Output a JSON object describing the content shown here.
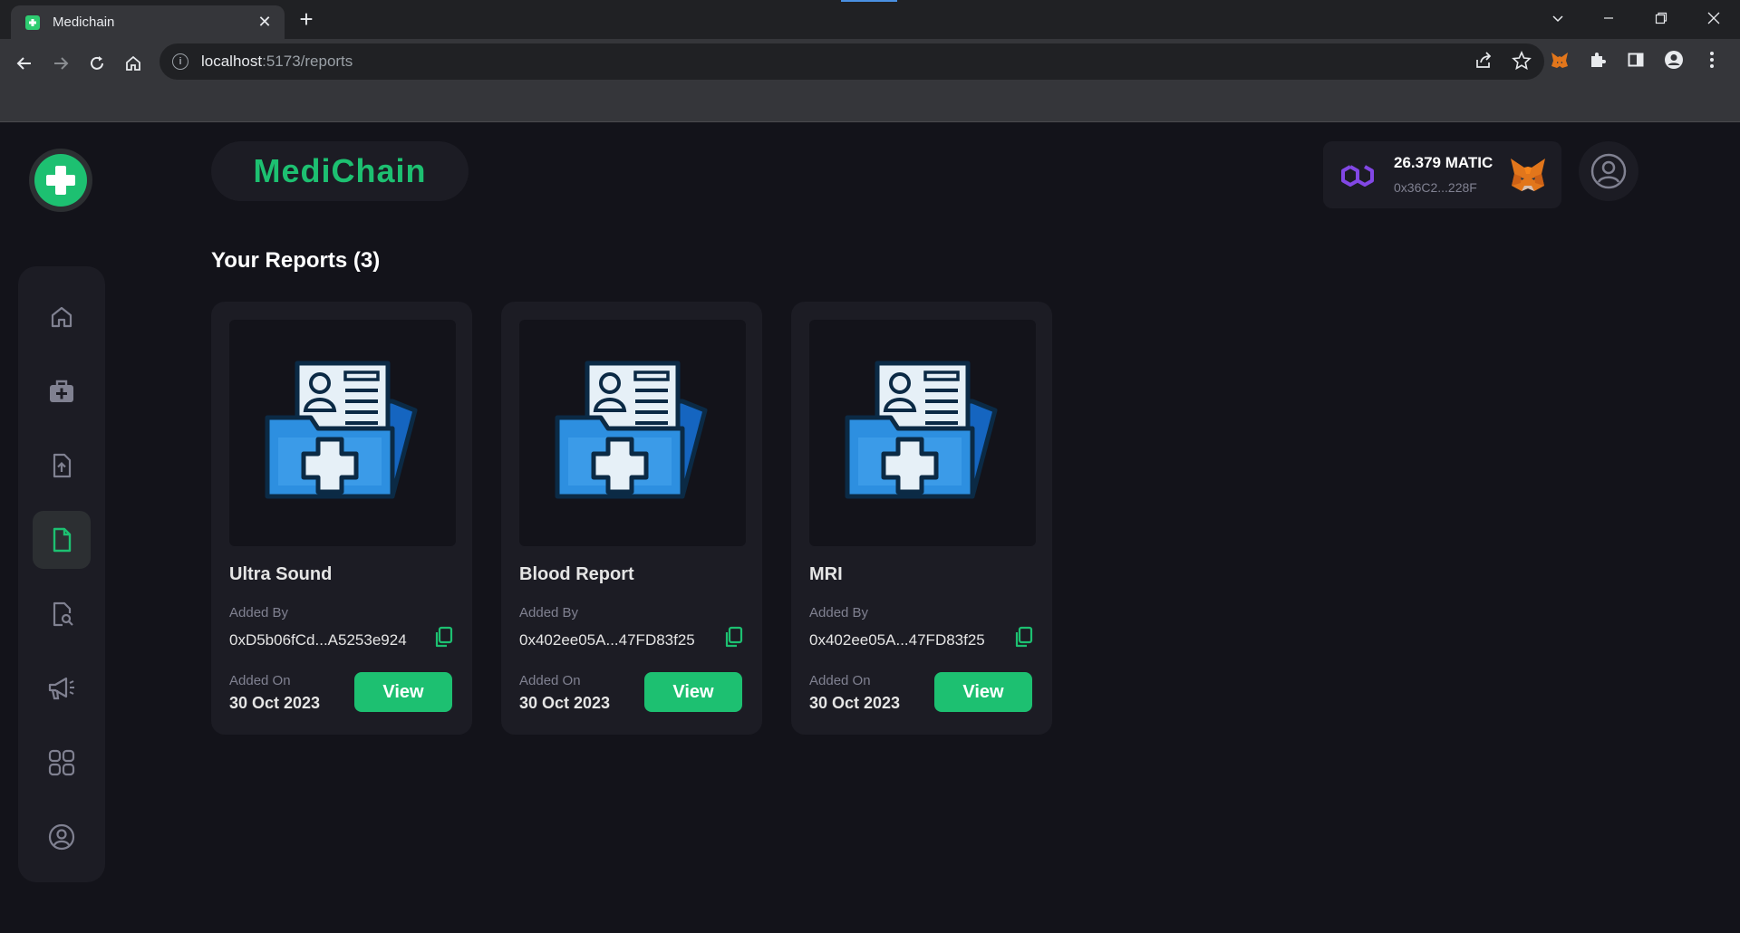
{
  "browser": {
    "tab_title": "Medichain",
    "new_tab_label": "+",
    "url_host": "localhost",
    "url_path": ":5173/reports"
  },
  "app": {
    "brand": "MediChain",
    "section_title": "Your Reports (3)"
  },
  "wallet": {
    "amount": "26.379 MATIC",
    "address": "0x36C2...228F"
  },
  "sidebar": {
    "items": [
      {
        "icon": "home-icon",
        "active": false
      },
      {
        "icon": "medical-kit-icon",
        "active": false
      },
      {
        "icon": "upload-file-icon",
        "active": false
      },
      {
        "icon": "document-icon",
        "active": true
      },
      {
        "icon": "search-document-icon",
        "active": false
      },
      {
        "icon": "megaphone-icon",
        "active": false
      },
      {
        "icon": "apps-grid-icon",
        "active": false
      },
      {
        "icon": "user-circle-icon",
        "active": false
      }
    ]
  },
  "reports": [
    {
      "title": "Ultra Sound",
      "added_by_label": "Added By",
      "added_by": "0xD5b06fCd...A5253e924",
      "added_on_label": "Added On",
      "date": "30 Oct 2023",
      "button": "View"
    },
    {
      "title": "Blood Report",
      "added_by_label": "Added By",
      "added_by": "0x402ee05A...47FD83f25",
      "added_on_label": "Added On",
      "date": "30 Oct 2023",
      "button": "View"
    },
    {
      "title": "MRI",
      "added_by_label": "Added By",
      "added_by": "0x402ee05A...47FD83f25",
      "added_on_label": "Added On",
      "date": "30 Oct 2023",
      "button": "View"
    }
  ],
  "colors": {
    "accent": "#1dc071",
    "background": "#13131a",
    "card": "#1c1c24",
    "polygon": "#8247e5"
  }
}
